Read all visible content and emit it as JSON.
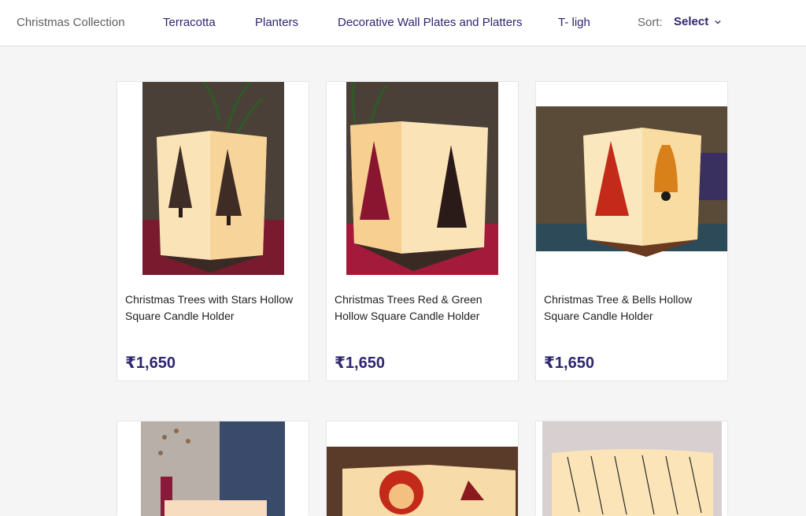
{
  "nav": {
    "breadcrumb": "Christmas Collection",
    "categories": [
      "Terracotta",
      "Planters",
      "Decorative Wall Plates and Platters",
      "T- ligh"
    ],
    "sort_label": "Sort:",
    "sort_value": "Select"
  },
  "products": [
    {
      "title": "Christmas Trees with Stars Hollow Square Candle Holder",
      "price": "₹1,650"
    },
    {
      "title": "Christmas Trees Red & Green Hollow Square Candle Holder",
      "price": "₹1,650"
    },
    {
      "title": "Christmas Tree & Bells Hollow Square Candle Holder",
      "price": "₹1,650"
    }
  ],
  "colors": {
    "accent": "#2d2670",
    "card_bg": "#ffffff",
    "page_bg": "#f5f5f5"
  }
}
